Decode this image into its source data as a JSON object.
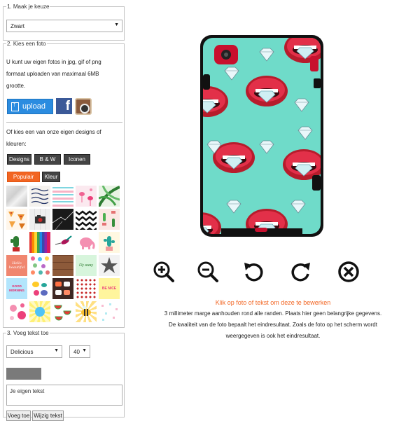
{
  "step1": {
    "legend": "1. Maak je keuze",
    "color_select": "Zwart"
  },
  "step2": {
    "legend": "2. Kies een foto",
    "upload_help": [
      "U kunt uw eigen fotos in jpg, gif of png",
      "formaat uploaden van maximaal 6MB",
      "grootte."
    ],
    "upload_label": "upload",
    "designs_help": [
      "Of kies een van onze eigen designs of",
      "kleuren:"
    ],
    "categories": [
      "Designs",
      "B & W",
      "Iconen"
    ],
    "subcategories": [
      "Populair",
      "Kleur"
    ],
    "active_subcategory": "Populair"
  },
  "step3": {
    "legend": "3. Voeg tekst toe",
    "font_select": "Delicious",
    "size_select": "40",
    "text_value": "Je eigen tekst",
    "add_button": "Voeg toe",
    "edit_button": "Wijzig tekst"
  },
  "tiles": [
    {
      "icon": "marble-gray"
    },
    {
      "icon": "handwriting"
    },
    {
      "icon": "pink-stripes"
    },
    {
      "icon": "flamingos"
    },
    {
      "icon": "palm-leaves"
    },
    {
      "icon": "pizza-pattern"
    },
    {
      "icon": "camera-on-tiles"
    },
    {
      "icon": "black-marble"
    },
    {
      "icon": "zigzag-bw"
    },
    {
      "icon": "cactus-pattern"
    },
    {
      "icon": "plant-cacti"
    },
    {
      "icon": "color-pencils"
    },
    {
      "icon": "hummingbirds"
    },
    {
      "icon": "pink-elephants"
    },
    {
      "icon": "cactus-mint"
    },
    {
      "icon": "hello-beautiful"
    },
    {
      "icon": "colorful-dots"
    },
    {
      "icon": "wood-planks"
    },
    {
      "icon": "fly-away-quote"
    },
    {
      "icon": "stars-gray"
    },
    {
      "icon": "good-morning"
    },
    {
      "icon": "colored-stones"
    },
    {
      "icon": "sushi"
    },
    {
      "icon": "dots-pattern"
    },
    {
      "icon": "be-nice-quote"
    },
    {
      "icon": "pink-floral"
    },
    {
      "icon": "summer-sun"
    },
    {
      "icon": "watermelons"
    },
    {
      "icon": "bee-sunburst"
    },
    {
      "icon": "pastel-confetti"
    }
  ],
  "tile_texts": {
    "hello": "Hello beautiful",
    "good_morning": "GOOD MORNING",
    "be_nice": "BE NICE",
    "fly_away": "Fly away"
  },
  "phone": {
    "case_color": "#111111",
    "print_bg": "#6fdbc9",
    "accent_red": "#c8102e"
  },
  "controls": {
    "zoom_in": "zoom-in-icon",
    "zoom_out": "zoom-out-icon",
    "rotate_left": "rotate-left-icon",
    "rotate_right": "rotate-right-icon",
    "remove": "remove-icon"
  },
  "instructions": {
    "edit_hint": "Klik op foto of tekst om deze te bewerken",
    "lines": [
      "3 millimeter marge aanhouden rond alle randen. Plaats hier geen belangrijke gegevens.",
      "De kwaliteit van de foto bepaalt het eindresultaat. Zoals de foto op het scherm wordt",
      "weergegeven is ook het eindresultaat."
    ]
  }
}
